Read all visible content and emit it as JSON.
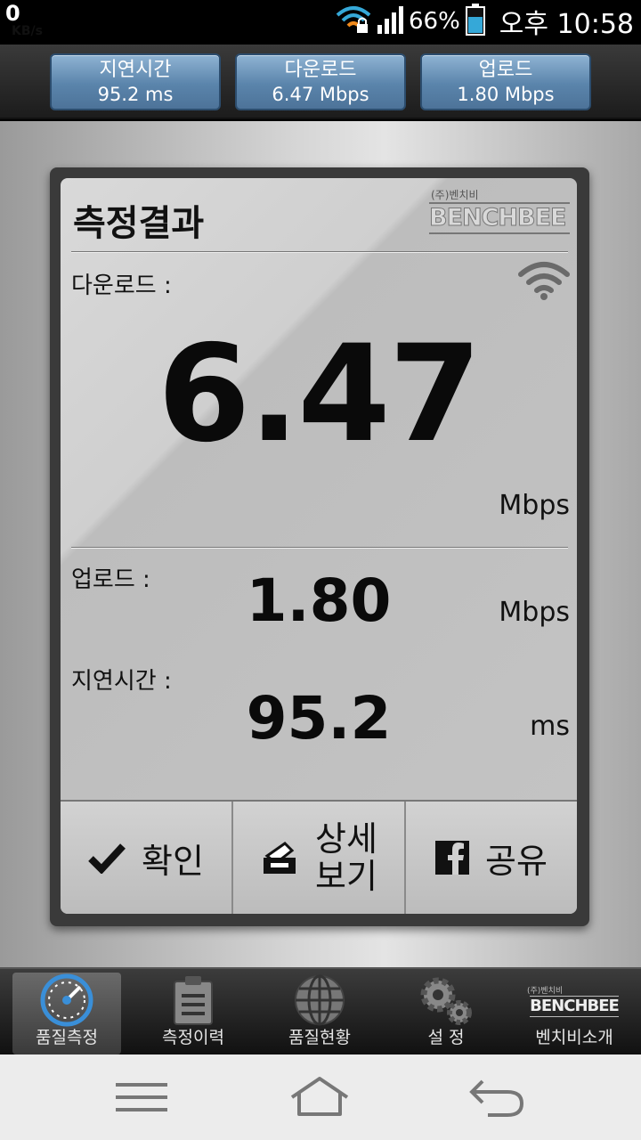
{
  "status_bar": {
    "net_speed": "0",
    "net_speed_unit": "KB/s",
    "battery": "66%",
    "time": "오후 10:58",
    "icons": [
      "wifi-lock-icon",
      "signal-icon",
      "battery-icon"
    ]
  },
  "summary_tabs": [
    {
      "label": "지연시간",
      "value": "95.2 ms"
    },
    {
      "label": "다운로드",
      "value": "6.47 Mbps"
    },
    {
      "label": "업로드",
      "value": "1.80 Mbps"
    }
  ],
  "result": {
    "title": "측정결과",
    "logo_small": "(주)벤치비",
    "logo_main": "BENCHBEE",
    "download_label": "다운로드 :",
    "download_value": "6.47",
    "download_unit": "Mbps",
    "upload_label": "업로드 :",
    "upload_value": "1.80",
    "upload_unit": "Mbps",
    "latency_label": "지연시간 :",
    "latency_value": "95.2",
    "latency_unit": "ms"
  },
  "actions": {
    "confirm": "확인",
    "detail_line1": "상세",
    "detail_line2": "보기",
    "share": "공유"
  },
  "bottom_nav": [
    {
      "label": "품질측정",
      "icon": "speedometer-icon",
      "active": true
    },
    {
      "label": "측정이력",
      "icon": "clipboard-icon",
      "active": false
    },
    {
      "label": "품질현황",
      "icon": "globe-icon",
      "active": false
    },
    {
      "label": "설 정",
      "icon": "gears-icon",
      "active": false
    },
    {
      "label": "벤치비소개",
      "icon": "benchbee-logo-icon",
      "active": false
    }
  ],
  "nav_logo": {
    "small": "(주)벤치비",
    "main": "BENCHBEE"
  },
  "colors": {
    "tab_blue": "#5a84ab",
    "accent_blue": "#3a8fd8",
    "wifi_orange": "#f08a1c"
  }
}
